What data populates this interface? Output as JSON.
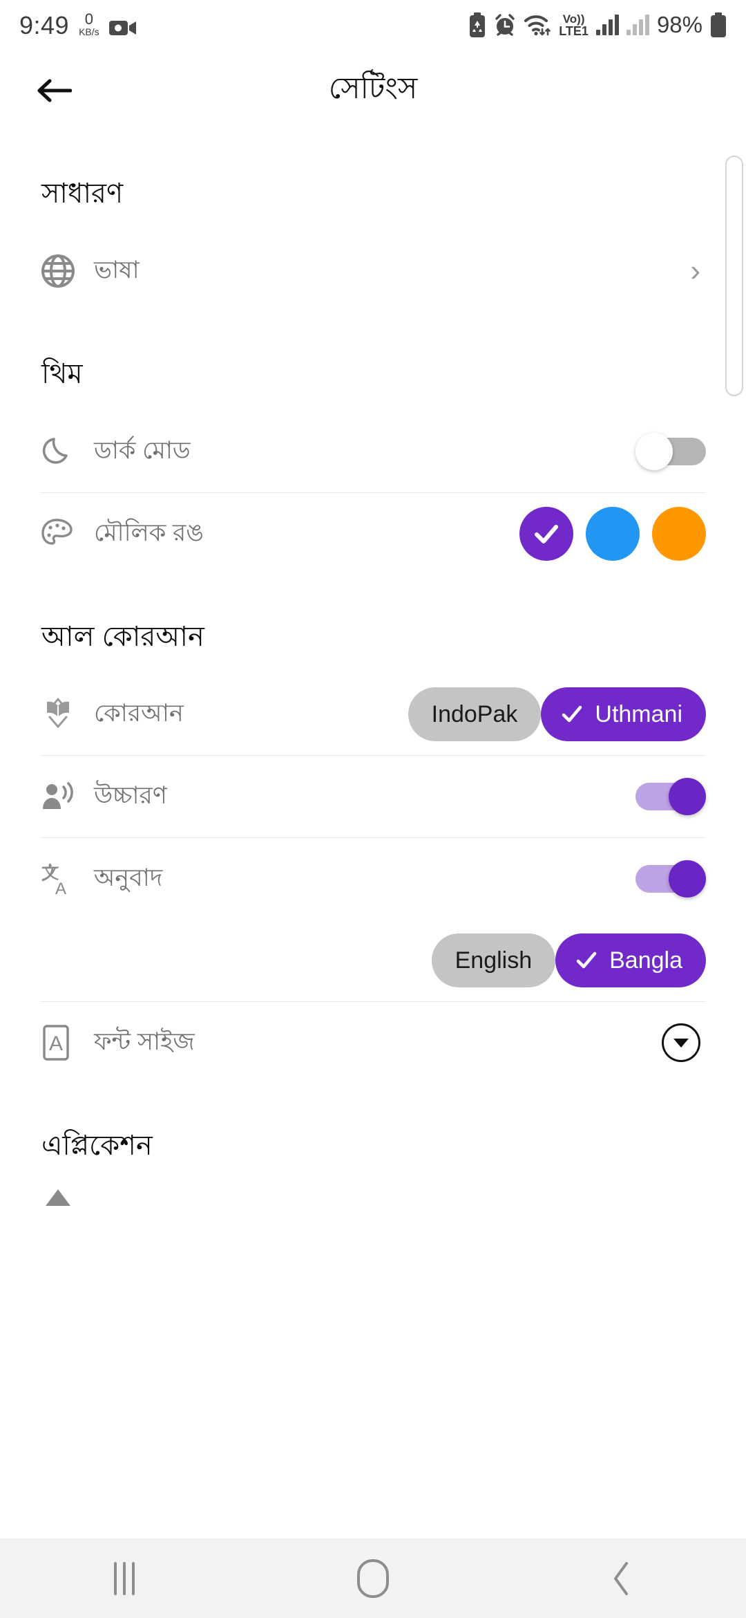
{
  "status_bar": {
    "clock": "9:49",
    "net_speed_value": "0",
    "net_speed_unit": "KB/s",
    "icons": [
      "screen-recorder-icon",
      "battery-saver-icon",
      "alarm-icon",
      "wifi-icon"
    ],
    "volte_top": "Vo))",
    "volte_bottom": "LTE1",
    "battery_percent": "98%"
  },
  "app_bar": {
    "back_icon": "back-arrow-icon",
    "title": "সেটিংস"
  },
  "sections": {
    "general": {
      "title": "সাধারণ",
      "language_row": {
        "icon": "globe-icon",
        "label": "ভাষা",
        "chevron": "›"
      }
    },
    "theme": {
      "title": "থিম",
      "dark_mode_row": {
        "icon": "moon-icon",
        "label": "ডার্ক মোড",
        "toggle_state": "off"
      },
      "primary_color_row": {
        "icon": "palette-icon",
        "label": "মৌলিক রঙ",
        "swatches": [
          {
            "name": "purple",
            "color": "#7129C9",
            "selected": true
          },
          {
            "name": "blue",
            "color": "#2196F3",
            "selected": false
          },
          {
            "name": "orange",
            "color": "#FF9800",
            "selected": false
          }
        ]
      }
    },
    "quran": {
      "title": "আল কোরআন",
      "script_row": {
        "icon": "quran-book-icon",
        "label": "কোরআন",
        "options": [
          {
            "label": "IndoPak",
            "selected": false
          },
          {
            "label": "Uthmani",
            "selected": true
          }
        ]
      },
      "pronunciation_row": {
        "icon": "pronunciation-icon",
        "label": "উচ্চারণ",
        "toggle_state": "on"
      },
      "translation_row": {
        "icon": "translate-icon",
        "label": "অনুবাদ",
        "toggle_state": "on"
      },
      "translation_language_options": [
        {
          "label": "English",
          "selected": false
        },
        {
          "label": "Bangla",
          "selected": true
        }
      ],
      "font_size_row": {
        "icon": "font-size-icon",
        "label": "ফন্ট সাইজ",
        "control": "dropdown-caret-icon"
      }
    },
    "application": {
      "title": "এপ্লিকেশন"
    }
  },
  "nav_bar": {
    "recents": "recents-icon",
    "home": "home-icon",
    "back": "back-icon"
  },
  "colors": {
    "accent": "#7129C9",
    "accent_light": "#bda2e6",
    "chip_unselected": "#c4c4c4",
    "label_gray": "#6f6f6f",
    "icon_gray": "#8a8a8a"
  }
}
